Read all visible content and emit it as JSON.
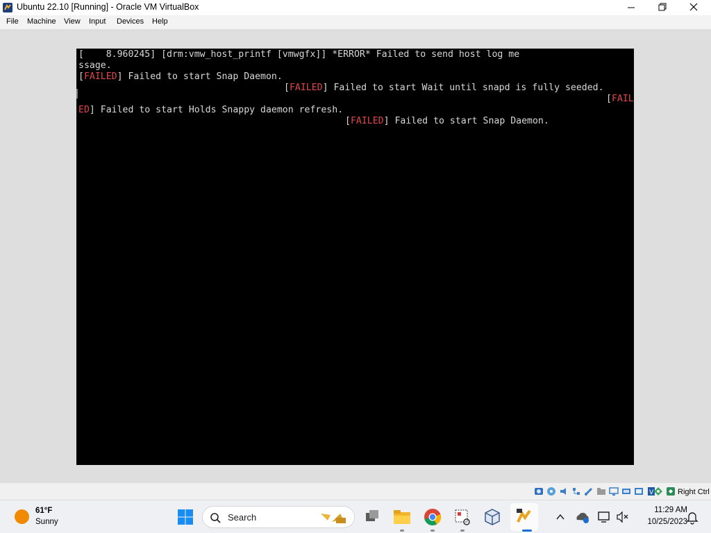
{
  "window": {
    "title": "Ubuntu 22.10 [Running] - Oracle VM VirtualBox"
  },
  "menu": {
    "items": [
      "File",
      "Machine",
      "View",
      "Input",
      "Devices",
      "Help"
    ]
  },
  "console": {
    "line1": "[    8.960245] [drm:vmw_host_printf [vmwgfx]] *ERROR* Failed to send host log me",
    "line2": "ssage.",
    "failed_label": "FAILED",
    "fail_split_a": "FAIL",
    "fail_split_b": "ED",
    "bracket_open": "[",
    "bracket_close": "]",
    "msg_snap_daemon": " Failed to start Snap Daemon.",
    "msg_wait_seeded": " Failed to start Wait until snapd is fully seeded.",
    "msg_holds_refresh": " Failed to start Holds Snappy daemon refresh.",
    "failed_color": "#e0474c",
    "text_color": "#d8d8d8"
  },
  "status_bar": {
    "host_key": "Right Ctrl",
    "icons": [
      "hard-disk-icon",
      "optical-drive-icon",
      "audio-icon",
      "network-icon",
      "usb-icon",
      "shared-folders-icon",
      "display-icon",
      "recording-icon",
      "virtualization-icon",
      "guest-additions-icon",
      "mouse-integration-icon",
      "host-key-icon"
    ]
  },
  "taskbar": {
    "weather_temp": "61°F",
    "weather_condition": "Sunny",
    "search_label": "Search",
    "clock_time": "11:29 AM",
    "clock_date": "10/25/2023"
  }
}
